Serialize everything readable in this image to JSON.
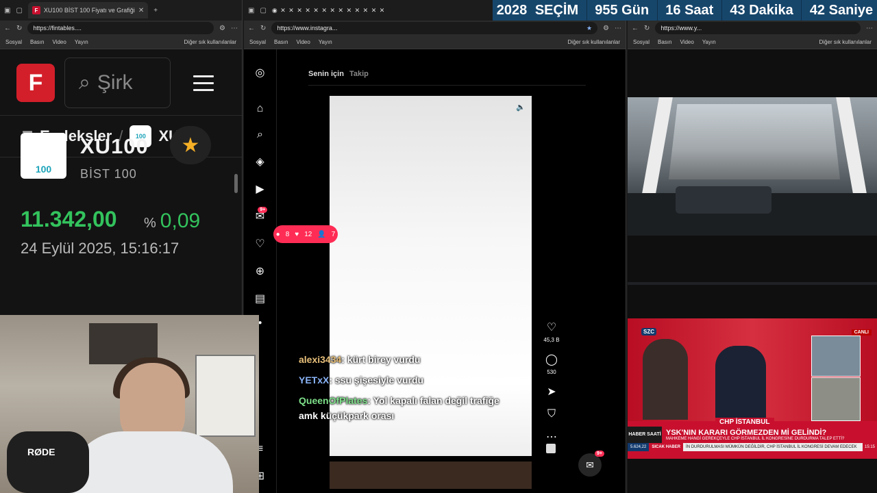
{
  "countdown": {
    "year": "2028",
    "event": "SEÇİM",
    "days": "955 Gün",
    "hours": "16 Saat",
    "minutes": "43 Dakika",
    "seconds": "42 Saniye"
  },
  "window1": {
    "tab_title": "XU100 BİST 100 Fiyatı ve Grafiği",
    "url": "https://fintables....",
    "bookmarks": [
      "Sosyal",
      "Basın",
      "Video",
      "Yayın"
    ],
    "bookmarks_right": "Diğer sık kullanılanlar",
    "logo_letter": "F",
    "search_placeholder": "Şirk",
    "breadcrumb": {
      "parent": "Endeksler",
      "sep": "/",
      "current": "XU..."
    },
    "index_logo_text": "100",
    "symbol": "XU100",
    "name": "BİST 100",
    "price": "11.342,00",
    "pct_sign": "%",
    "pct": "0,09",
    "datetime": "24 Eylül 2025, 15:16:17"
  },
  "webcam": {
    "mic_brand": "RØDE"
  },
  "window2": {
    "url": "https://www.instagra...",
    "bookmarks": [
      "Sosyal",
      "Basın",
      "Video",
      "Yayın"
    ],
    "bookmarks_right": "Diğer sık kullanılanlar",
    "feed_tabs": [
      "Senin için",
      "Takip"
    ],
    "notif": {
      "comments": "8",
      "likes": "12",
      "follows": "7"
    },
    "likes": "45,3 B",
    "comments": "530",
    "chat": [
      {
        "user": "alexi3434",
        "text": ": kürt birey vurdu"
      },
      {
        "user": "YETxX",
        "text": ": ssu şişesiyle vurdu"
      },
      {
        "user": "QueenOfPlates",
        "text": ": Yol kapalı falan değil trafiğe amk küçükpark orası"
      }
    ],
    "msg_badge": "9+",
    "nav_badge": "9+"
  },
  "window3": {
    "url": "https://www.y...",
    "bookmarks": [
      "Sosyal",
      "Basın",
      "Video",
      "Yayın"
    ],
    "bookmarks_right": "Diğer sık kullanılanlar",
    "news": {
      "channel": "SZC",
      "live": "CANLI",
      "party": "CHP İSTANBUL",
      "tag": "HABER SAATİ",
      "headline": "YSK'NIN KARARI GÖRMEZDEN Mİ GELİNDİ?",
      "subline": "MAHKEME HANGİ GEREKÇEYLE CHP İSTANBUL İL KONGRESİNE DURDURMA TALEP ETTİ?",
      "ticker_value": "5.624,22",
      "ticker_label": "SICAK HABER",
      "ticker_text": "İN DURDURULMASI MÜMKÜN DEĞİLDİR, CHP İSTANBUL İL KONGRESİ DEVAM EDECEK",
      "time": "15:15"
    }
  }
}
